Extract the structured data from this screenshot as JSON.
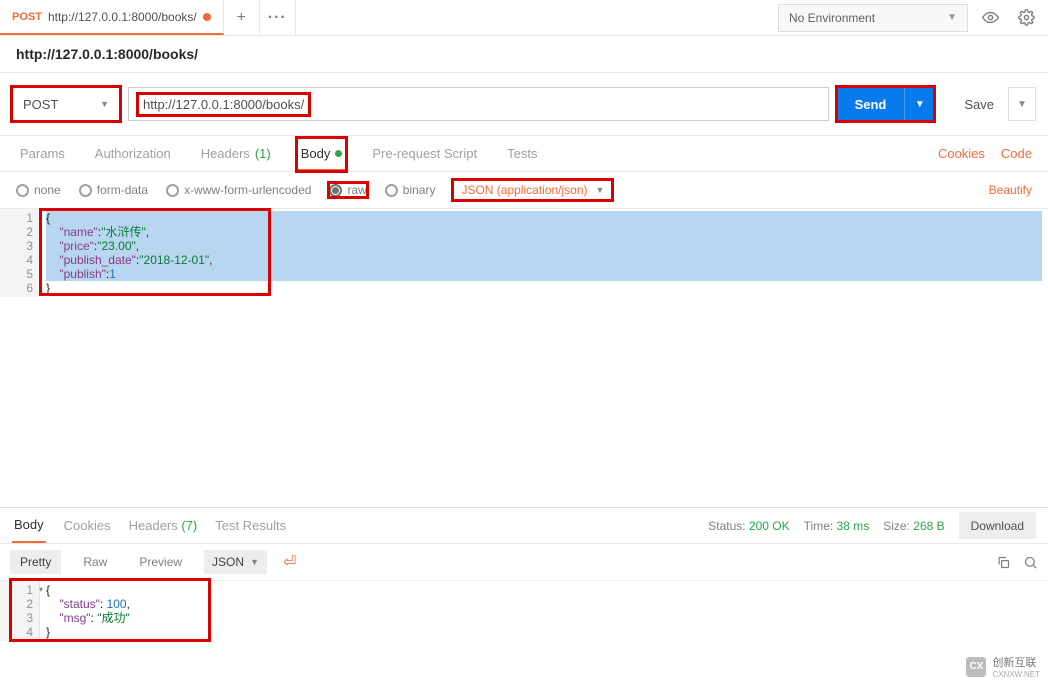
{
  "top": {
    "tab_method": "POST",
    "tab_label": "http://127.0.0.1:8000/books/",
    "env_label": "No Environment"
  },
  "title": "http://127.0.0.1:8000/books/",
  "request": {
    "method": "POST",
    "url": "http://127.0.0.1:8000/books/",
    "send_label": "Send",
    "save_label": "Save"
  },
  "subtabs": {
    "params": "Params",
    "auth": "Authorization",
    "headers": "Headers",
    "headers_count": "(1)",
    "body": "Body",
    "prereq": "Pre-request Script",
    "tests": "Tests",
    "cookies": "Cookies",
    "code": "Code"
  },
  "body_opts": {
    "none": "none",
    "formdata": "form-data",
    "xform": "x-www-form-urlencoded",
    "raw": "raw",
    "binary": "binary",
    "content_type": "JSON (application/json)",
    "beautify": "Beautify"
  },
  "request_body": {
    "lines": [
      "1",
      "2",
      "3",
      "4",
      "5",
      "6"
    ],
    "line1": "{",
    "k_name": "\"name\"",
    "v_name": "\"水浒传\"",
    "k_price": "\"price\"",
    "v_price": "\"23.00\"",
    "k_pubdate": "\"publish_date\"",
    "v_pubdate": "\"2018-12-01\"",
    "k_publish": "\"publish\"",
    "v_publish": "1",
    "line6": "}"
  },
  "response_tabs": {
    "body": "Body",
    "cookies": "Cookies",
    "headers": "Headers",
    "headers_count": "(7)",
    "test_results": "Test Results"
  },
  "status": {
    "status_label": "Status:",
    "status_value": "200 OK",
    "time_label": "Time:",
    "time_value": "38 ms",
    "size_label": "Size:",
    "size_value": "268 B",
    "download": "Download"
  },
  "view": {
    "pretty": "Pretty",
    "raw": "Raw",
    "preview": "Preview",
    "fmt": "JSON"
  },
  "response_body": {
    "lines": [
      "1",
      "2",
      "3",
      "4"
    ],
    "line1": "{",
    "k_status": "\"status\"",
    "v_status": "100",
    "k_msg": "\"msg\"",
    "v_msg": "\"成功\"",
    "line4": "}"
  },
  "logo": {
    "brand": "创新互联",
    "sub": "CXNXW.NET"
  }
}
